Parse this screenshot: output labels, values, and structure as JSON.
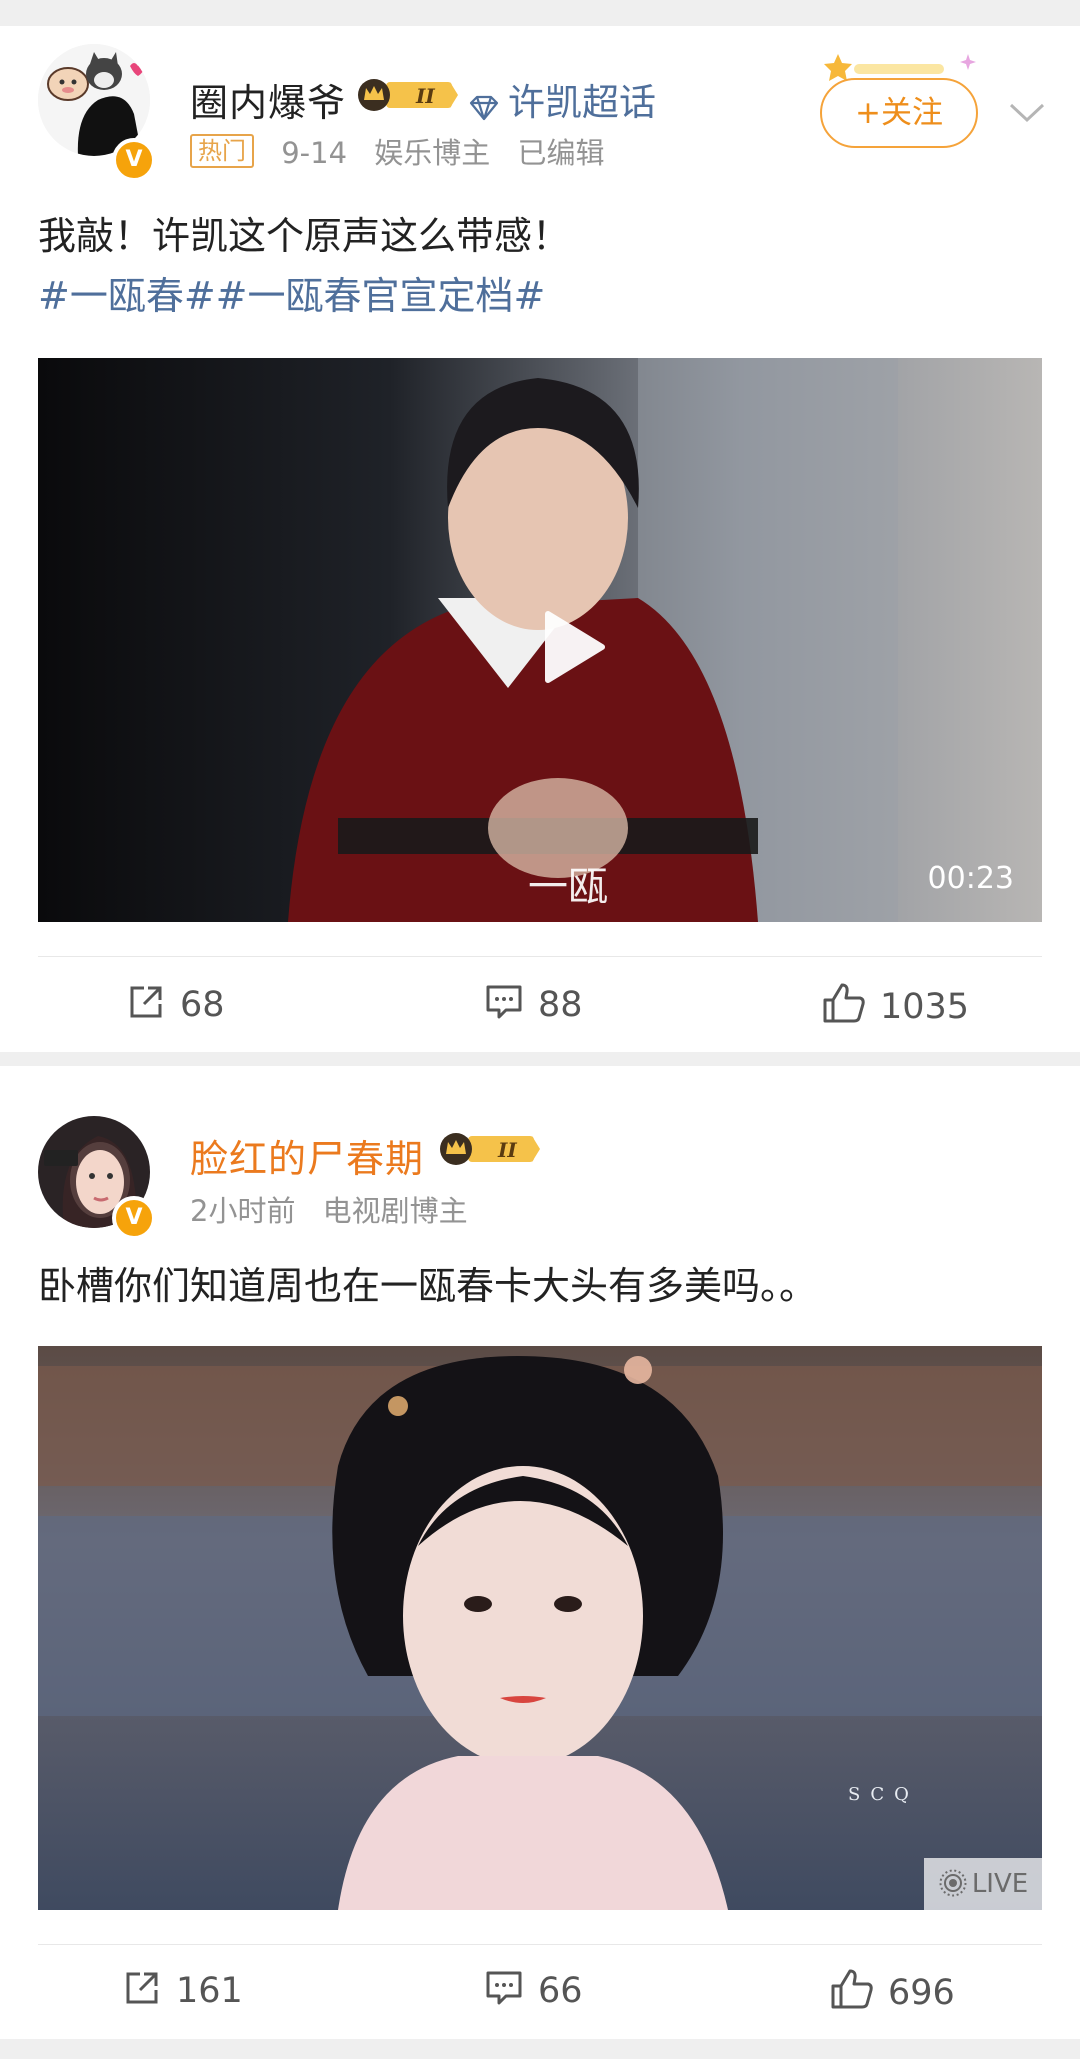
{
  "posts": [
    {
      "username": "圈内爆爷",
      "vip_level": "II",
      "hot_label": "热门",
      "date": "9-14",
      "role": "娱乐博主",
      "edited": "已编辑",
      "super_topic": "许凯超话",
      "follow_label": "+关注",
      "text": "我敲！许凯这个原声这么带感！",
      "hashtags": "#一瓯春##一瓯春官宣定档#",
      "video_duration": "00:23",
      "video_watermark": "一瓯",
      "reposts": "68",
      "comments": "88",
      "likes": "1035"
    },
    {
      "username": "脸红的尸春期",
      "vip_level": "II",
      "time": "2小时前",
      "role": "电视剧博主",
      "text": "卧槽你们知道周也在一瓯春卡大头有多美吗。。",
      "image_watermark": "SCQ",
      "live_label": "LIVE",
      "reposts": "161",
      "comments": "66",
      "likes": "696"
    }
  ],
  "colors": {
    "link_blue": "#4f6f9b",
    "username_orange": "#eb7a1e",
    "follow_orange": "#ee8e1b",
    "verified_gold": "#f6a30b"
  },
  "icons": [
    "repost-icon",
    "comment-icon",
    "like-icon",
    "play-icon",
    "chevron-down-icon",
    "diamond-icon",
    "live-icon",
    "vip-crown-badge"
  ]
}
